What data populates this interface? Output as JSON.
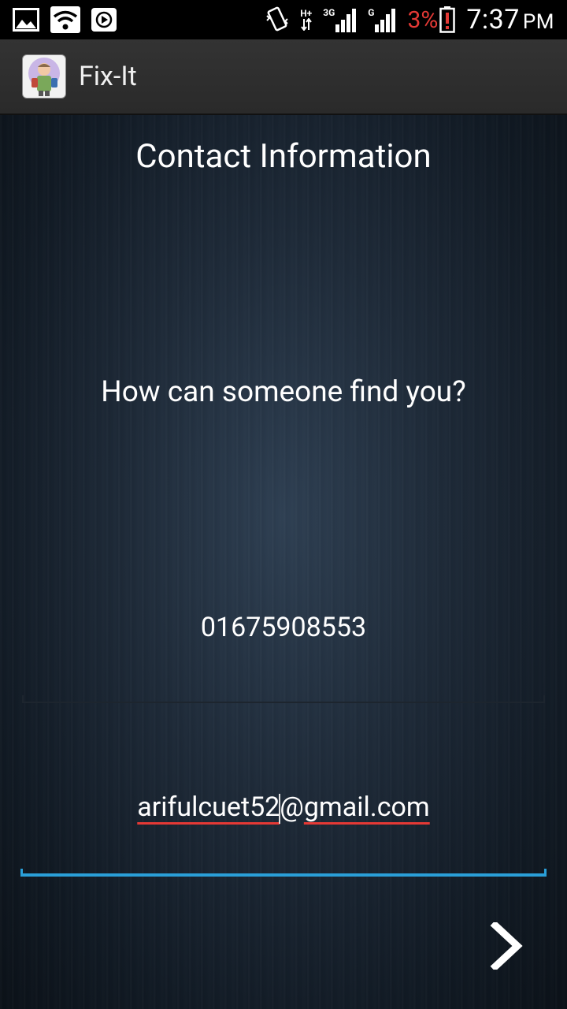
{
  "status_bar": {
    "icons_left": [
      "gallery-icon",
      "wifi-icon",
      "media-icon"
    ],
    "icons_right": [
      "vibrate-icon",
      "hplus-network-icon",
      "signal-3g-icon",
      "signal-g-icon",
      "battery-low-icon"
    ],
    "network_hplus": "H+",
    "network_3g": "3G",
    "network_g": "G",
    "battery": "3%",
    "time": "7:37",
    "ampm": "PM",
    "battery_color": "#e53935"
  },
  "action_bar": {
    "title": "Fix-It",
    "icon": "app-logo-icon"
  },
  "content": {
    "heading": "Contact Information",
    "question": "How can someone find you?",
    "phone_value": "01675908553",
    "email_part1": "arifulcuet52",
    "email_at": "@",
    "email_part2": "gmail.com",
    "accent_color": "#2a9fd8",
    "next_icon": "chevron-right-icon"
  }
}
